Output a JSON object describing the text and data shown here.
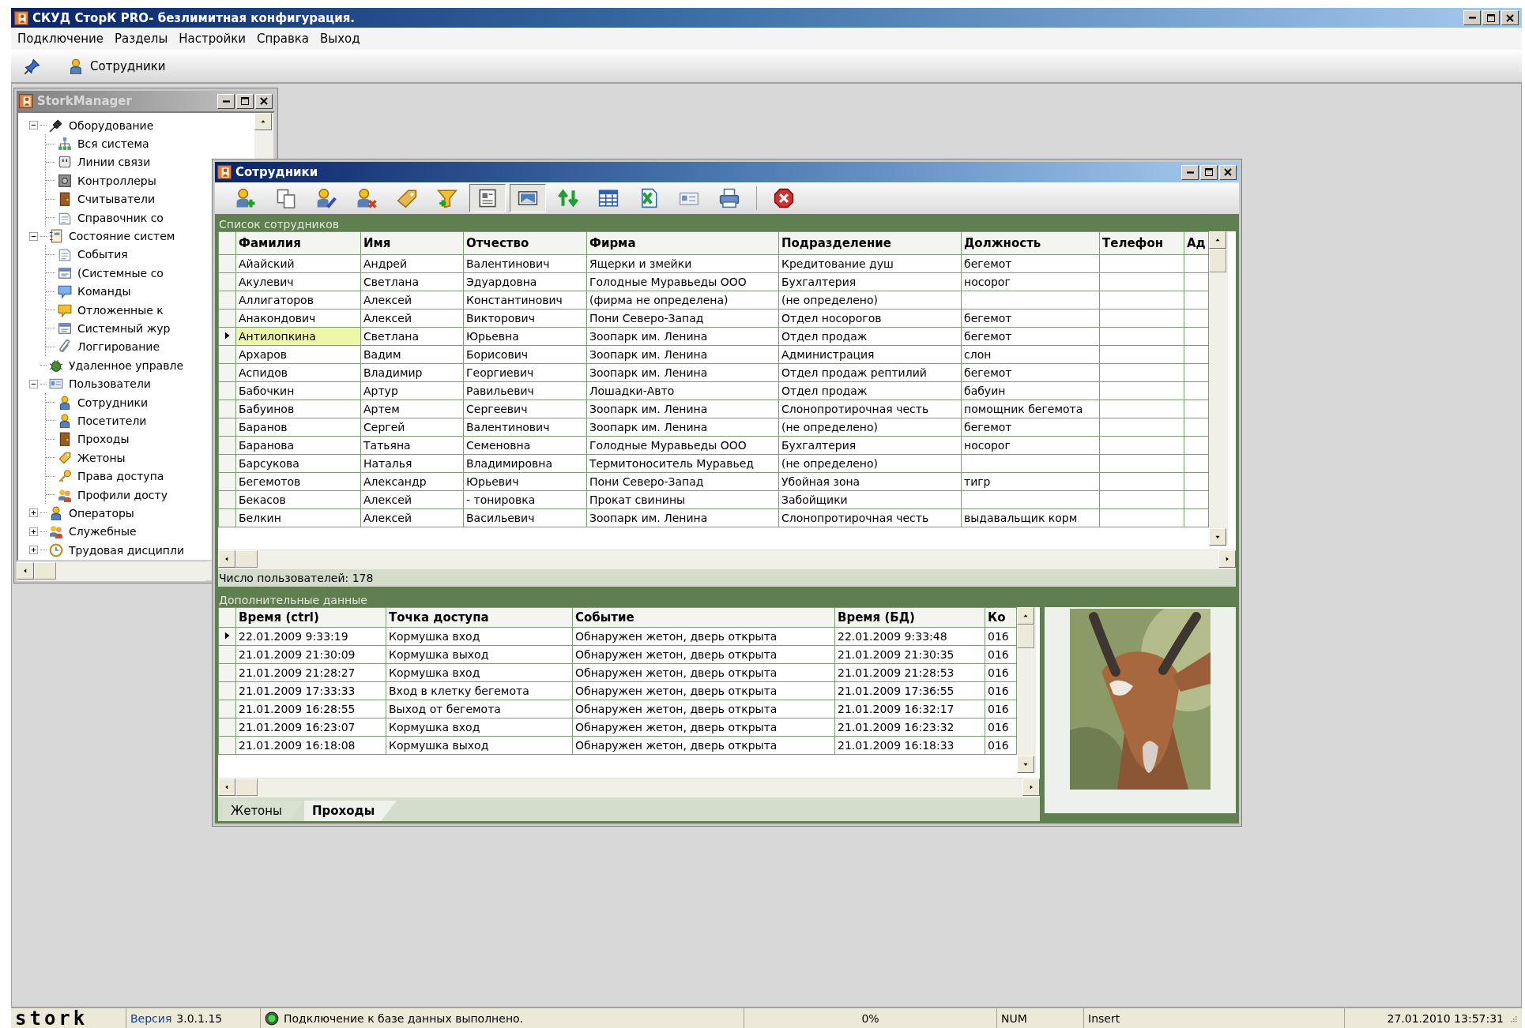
{
  "window": {
    "title": "СКУД СторК PRO- безлимитная конфигурация."
  },
  "menu": [
    "Подключение",
    "Разделы",
    "Настройки",
    "Справка",
    "Выход"
  ],
  "main_toolbar": {
    "section_button": "Сотрудники"
  },
  "manager_window": {
    "title": "StorkManager",
    "active": false,
    "tree": [
      {
        "label": "Оборудование",
        "expanded": true,
        "children": [
          {
            "label": "Вся система"
          },
          {
            "label": "Линии связи"
          },
          {
            "label": "Контроллеры"
          },
          {
            "label": "Считыватели"
          },
          {
            "label": "Справочник со"
          }
        ]
      },
      {
        "label": "Состояние систем",
        "expanded": true,
        "children": [
          {
            "label": "События"
          },
          {
            "label": "(Системные со"
          },
          {
            "label": "Команды"
          },
          {
            "label": "Отложенные к"
          },
          {
            "label": "Системный жур"
          },
          {
            "label": "Логгирование"
          }
        ]
      },
      {
        "label": "Удаленное управле"
      },
      {
        "label": "Пользователи",
        "expanded": true,
        "children": [
          {
            "label": "Сотрудники"
          },
          {
            "label": "Посетители"
          },
          {
            "label": "Проходы"
          },
          {
            "label": "Жетоны"
          },
          {
            "label": "Права доступа"
          },
          {
            "label": "Профили досту"
          }
        ]
      },
      {
        "label": "Операторы",
        "expanded": false
      },
      {
        "label": "Служебные",
        "expanded": false
      },
      {
        "label": "Трудовая дисципли",
        "expanded": false
      }
    ]
  },
  "employees_window": {
    "title": "Сотрудники",
    "active": true,
    "toolbar": [
      {
        "pressed": false
      },
      {
        "pressed": false
      },
      {
        "pressed": false
      },
      {
        "pressed": false
      },
      {
        "pressed": false
      },
      {
        "pressed": false
      },
      {
        "pressed": true
      },
      {
        "pressed": true
      },
      {
        "pressed": false
      },
      {
        "pressed": false
      },
      {
        "pressed": false
      },
      {
        "pressed": false
      },
      {
        "pressed": false
      },
      {
        "pressed": false
      }
    ],
    "list_title": "Список сотрудников",
    "columns": [
      "Фамилия",
      "Имя",
      "Отчество",
      "Фирма",
      "Подразделение",
      "Должность",
      "Телефон",
      "Ад"
    ],
    "rows": [
      {
        "selected": false,
        "surname": "Айайский",
        "name": "Андрей",
        "patronymic": "Валентинович",
        "company": "Ящерки и змейки",
        "department": "Кредитование душ",
        "position": "бегемот"
      },
      {
        "selected": false,
        "surname": "Акулевич",
        "name": "Светлана",
        "patronymic": "Эдуардовна",
        "company": "Голодные Муравьеды ООО",
        "department": "Бухгалтерия",
        "position": "носорог"
      },
      {
        "selected": false,
        "surname": "Аллигаторов",
        "name": "Алексей",
        "patronymic": "Константинович",
        "company": "(фирма не определена)",
        "department": "(не определено)"
      },
      {
        "selected": false,
        "surname": "Анакондович",
        "name": "Алексей",
        "patronymic": "Викторович",
        "company": "Пони Северо-Запад",
        "department": "Отдел носорогов",
        "position": "бегемот"
      },
      {
        "selected": true,
        "surname": "Антилопкина",
        "name": "Светлана",
        "patronymic": "Юрьевна",
        "company": "Зоопарк им. Ленина",
        "department": "Отдел продаж",
        "position": "бегемот"
      },
      {
        "selected": false,
        "surname": "Архаров",
        "name": "Вадим",
        "patronymic": "Борисович",
        "company": "Зоопарк им. Ленина",
        "department": "Администрация",
        "position": "слон"
      },
      {
        "selected": false,
        "surname": "Аспидов",
        "name": "Владимир",
        "patronymic": "Георгиевич",
        "company": "Зоопарк им. Ленина",
        "department": "Отдел продаж рептилий",
        "position": "бегемот"
      },
      {
        "selected": false,
        "surname": "Бабочкин",
        "name": "Артур",
        "patronymic": "Равильевич",
        "company": "Лошадки-Авто",
        "department": "Отдел продаж",
        "position": "бабуин"
      },
      {
        "selected": false,
        "surname": "Бабуинов",
        "name": "Артем",
        "patronymic": "Сергеевич",
        "company": "Зоопарк им. Ленина",
        "department": "Слонопротирочная честь",
        "position": "помощник бегемота"
      },
      {
        "selected": false,
        "surname": "Баранов",
        "name": "Сергей",
        "patronymic": "Валентинович",
        "company": "Зоопарк им. Ленина",
        "department": "(не определено)",
        "position": "бегемот"
      },
      {
        "selected": false,
        "surname": "Баранова",
        "name": "Татьяна",
        "patronymic": "Семеновна",
        "company": "Голодные Муравьеды ООО",
        "department": "Бухгалтерия",
        "position": "носорог"
      },
      {
        "selected": false,
        "surname": "Барсукова",
        "name": "Наталья",
        "patronymic": "Владимировна",
        "company": "Термитоноситель Муравьед",
        "department": "(не определено)"
      },
      {
        "selected": false,
        "surname": "Бегемотов",
        "name": "Александр",
        "patronymic": "Юрьевич",
        "company": "Пони Северо-Запад",
        "department": "Убойная зона",
        "position": "тигр"
      },
      {
        "selected": false,
        "surname": "Бекасов",
        "name": "Алексей",
        "patronymic": "- тонировка",
        "company": "Прокат свинины",
        "department": "Забойщики"
      },
      {
        "selected": false,
        "surname": "Белкин",
        "name": "Алексей",
        "patronymic": "Васильевич",
        "company": "Зоопарк им. Ленина",
        "department": "Слонопротирочная честь",
        "position": "выдавальщик корм"
      }
    ],
    "count": "Число пользователей: 178",
    "details_title": "Дополнительные данные",
    "events": {
      "columns": [
        "Время (ctrl)",
        "Точка доступа",
        "Событие",
        "Время (БД)",
        "Ко"
      ],
      "rows": [
        {
          "selected": true,
          "time_ctrl": "22.01.2009 9:33:19",
          "access_point": "Кормушка вход",
          "event": "Обнаружен жетон, дверь открыта",
          "time_db": "22.01.2009 9:33:48",
          "code": "016"
        },
        {
          "selected": false,
          "time_ctrl": "21.01.2009 21:30:09",
          "access_point": "Кормушка  выход",
          "event": "Обнаружен жетон, дверь открыта",
          "time_db": "21.01.2009 21:30:35",
          "code": "016"
        },
        {
          "selected": false,
          "time_ctrl": "21.01.2009 21:28:27",
          "access_point": "Кормушка вход",
          "event": "Обнаружен жетон, дверь открыта",
          "time_db": "21.01.2009 21:28:53",
          "code": "016"
        },
        {
          "selected": false,
          "time_ctrl": "21.01.2009 17:33:33",
          "access_point": "Вход в клетку бегемота",
          "event": "Обнаружен жетон, дверь открыта",
          "time_db": "21.01.2009 17:36:55",
          "code": "016"
        },
        {
          "selected": false,
          "time_ctrl": "21.01.2009 16:28:55",
          "access_point": "Выход от бегемота",
          "event": "Обнаружен жетон, дверь открыта",
          "time_db": "21.01.2009 16:32:17",
          "code": "016"
        },
        {
          "selected": false,
          "time_ctrl": "21.01.2009 16:23:07",
          "access_point": "Кормушка вход",
          "event": "Обнаружен жетон, дверь открыта",
          "time_db": "21.01.2009 16:23:32",
          "code": "016"
        },
        {
          "selected": false,
          "time_ctrl": "21.01.2009 16:18:08",
          "access_point": "Кормушка  выход",
          "event": "Обнаружен жетон, дверь открыта",
          "time_db": "21.01.2009 16:18:33",
          "code": "016"
        }
      ]
    },
    "tabs": [
      {
        "label": "Жетоны",
        "selected": false
      },
      {
        "label": "Проходы",
        "selected": true
      }
    ]
  },
  "status_bar": {
    "logo": "stork",
    "version_label": "Версия",
    "version": "3.0.1.15",
    "connection": "Подключение к базе данных выполнено.",
    "progress": "0%",
    "num": "NUM",
    "mode": "Insert",
    "datetime": "27.01.2010 13:57:31"
  }
}
